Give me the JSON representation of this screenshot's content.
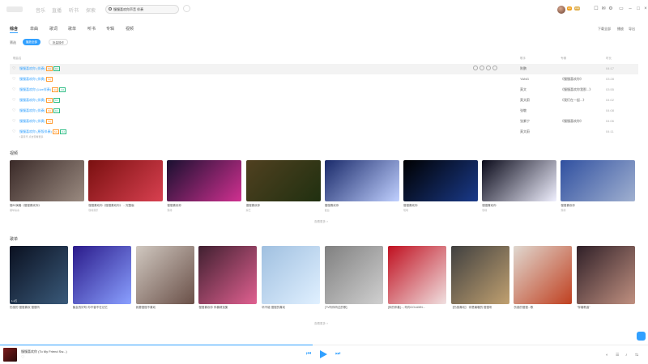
{
  "header": {
    "nav": [
      "音乐",
      "直播",
      "听书",
      "探索"
    ],
    "search_value": "慢慢喜欢你声音 伴奏",
    "badges": [
      "vip",
      "svip"
    ]
  },
  "tabs": [
    "综合",
    "单曲",
    "歌词",
    "歌单",
    "听书",
    "专辑",
    "视频"
  ],
  "right_links": [
    "下载全部",
    "播放",
    "导出"
  ],
  "filters": {
    "label": "筛选",
    "pills": [
      "播放全部",
      "批量操作"
    ]
  },
  "table_headers": {
    "song": "歌曲名",
    "singer": "歌手",
    "album": "专辑",
    "time": "时长"
  },
  "songs": [
    {
      "title": "慢慢喜欢你 (伴奏)",
      "tags": [
        "SQ",
        "DJ"
      ],
      "singer": "陈鹏",
      "album": "",
      "time": "04:17"
    },
    {
      "title": "慢慢喜欢你 (伴奏)",
      "tags": [
        "SQ"
      ],
      "singer": "YANG",
      "album": "《慢慢喜欢你》",
      "time": "03:28"
    },
    {
      "title": "慢慢喜欢你 (Live伴奏)",
      "tags": [
        "SQ",
        "DJ"
      ],
      "singer": "莫文",
      "album": "《慢慢喜欢你我那...》",
      "time": "03:55"
    },
    {
      "title": "慢慢喜欢你 (伴奏)",
      "tags": [
        "SQ",
        "DJ"
      ],
      "singer": "莫文蔚",
      "album": "《我们在一起...》",
      "time": "04:02"
    },
    {
      "title": "慢慢喜欢你 (伴奏)",
      "tags": [
        "SQ",
        "DJ"
      ],
      "singer": "张敬",
      "album": "",
      "time": "04:08"
    },
    {
      "title": "慢慢喜欢你 (伴奏)",
      "tags": [
        "SQ"
      ],
      "singer": "张紫宁",
      "album": "《慢慢喜欢你》",
      "time": "04:06"
    },
    {
      "title": "慢慢喜欢你 (原版伴奏)",
      "tags": [
        "SQ",
        "DJ"
      ],
      "singer": "莫文蔚",
      "album": "",
      "time": "04:11",
      "note": "1首音乐 点击查看更多"
    }
  ],
  "video_section": {
    "title": "视频",
    "more": "查看更多 >"
  },
  "videos": [
    {
      "caption": "慢80演奏《慢慢喜欢你》",
      "sub": "钢琴演奏",
      "c1": "#3a2a28",
      "c2": "#9a8a80"
    },
    {
      "caption": "慢慢喜欢你《慢慢喜欢你》 ...完整版",
      "sub": "现场音乐",
      "c1": "#7a1010",
      "c2": "#d84050"
    },
    {
      "caption": "慢慢喜欢你",
      "sub": "现场",
      "c1": "#1a1030",
      "c2": "#d03090"
    },
    {
      "caption": "慢慢喜欢你",
      "sub": "综艺",
      "c1": "#504020",
      "c2": "#203010"
    },
    {
      "caption": "慢慢喜欢你",
      "sub": "舞台",
      "c1": "#1a2a6a",
      "c2": "#c0d0ff"
    },
    {
      "caption": "慢慢喜欢你",
      "sub": "现场",
      "c1": "#000000",
      "c2": "#1a3a8a"
    },
    {
      "caption": "慢慢喜欢你",
      "sub": "现场",
      "c1": "#0a0a1a",
      "c2": "#f0f0ff"
    },
    {
      "caption": "慢慢喜欢你",
      "sub": "现场",
      "c1": "#3050a0",
      "c2": "#a0b0d0"
    }
  ],
  "playlist_section": {
    "title": "歌单",
    "more": "查看更多 >"
  },
  "playlists": [
    {
      "caption": "伤感的 慢慢喜欢 慢慢听",
      "count": "1.4万",
      "c1": "#0a1020",
      "c2": "#3a5a7a"
    },
    {
      "caption": "聚会的好听 你不曾不在记忆",
      "count": "",
      "c1": "#2a1a8a",
      "c2": "#8aa0ff"
    },
    {
      "caption": "我要慢慢不喜欢",
      "count": "",
      "c1": "#d0c8c0",
      "c2": "#6a5048"
    },
    {
      "caption": "慢慢喜欢你 伴奏精选集",
      "count": "",
      "c1": "#402030",
      "c2": "#e06090"
    },
    {
      "caption": "听不能 慢慢的喜欢",
      "count": "",
      "c1": "#a0c0e0",
      "c2": "#e0f0ff"
    },
    {
      "caption": "[TV听你听过的歌]",
      "count": "",
      "c1": "#808080",
      "c2": "#d0d0d0"
    },
    {
      "caption": "[你的伴奏]..., 听你COLUMN...",
      "count": "",
      "c1": "#c01020",
      "c2": "#f0e0e0"
    },
    {
      "caption": "【伤感喜欢】 你是最暖的 慢慢听",
      "count": "",
      "c1": "#404040",
      "c2": "#c0a070"
    },
    {
      "caption": "伤感的慢慢...歌",
      "count": "",
      "c1": "#e0d8d0",
      "c2": "#c04020"
    },
    {
      "caption": "\"伴奏歌曲\"",
      "count": "",
      "c1": "#302028",
      "c2": "#c09080"
    }
  ],
  "player": {
    "song": "慢慢喜欢你 (To My Friend Sw...)",
    "accent": "#31a0ff"
  }
}
